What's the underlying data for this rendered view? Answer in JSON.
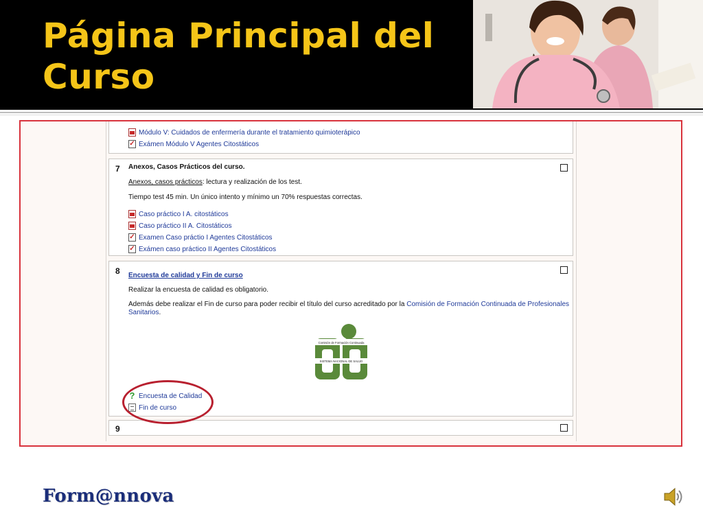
{
  "slide": {
    "title_line1": "Página Principal del",
    "title_line2": "Curso",
    "brand": "Form@nnova"
  },
  "colors": {
    "header_bg": "#000000",
    "title": "#f5c518",
    "frame_border": "#d8323c",
    "link": "#1f3a99",
    "logo_green": "#5a8a3a",
    "highlight_oval": "#b8202f"
  },
  "sections": {
    "prev": {
      "items": [
        {
          "icon": "pdf-icon",
          "label": "Módulo V: Cuidados de enfermería durante el tratamiento quimioterápico"
        },
        {
          "icon": "quiz-icon",
          "label": "Exámen Módulo V Agentes Citostáticos"
        }
      ]
    },
    "s7": {
      "number": "7",
      "title": "Anexos, Casos Prácticos del curso.",
      "summary_link": "Anexos, casos prácticos",
      "summary_rest": ": lectura y realización de los test.",
      "note": "Tiempo test 45 min. Un único intento y mínimo un 70% respuestas correctas.",
      "items": [
        {
          "icon": "pdf-icon",
          "label": "Caso práctico I A. citostáticos"
        },
        {
          "icon": "pdf-icon",
          "label": "Caso práctico II A. Citostáticos"
        },
        {
          "icon": "quiz-icon",
          "label": "Examen Caso práctio I Agentes Citostáticos"
        },
        {
          "icon": "quiz-icon",
          "label": "Exámen caso práctico II Agentes Citostáticos"
        }
      ]
    },
    "s8": {
      "number": "8",
      "title": "Encuesta de calidad y Fin de curso",
      "line1": "Realizar la encuesta de calidad es obligatorio.",
      "line2_start": "Además debe realizar el Fin de curso para poder recibir el título del curso acreditado por la",
      "line2_link_a": "Comisión de Formación Continuada de Profesionales",
      "line2_link_b": "Sanitarios",
      "line2_end": ".",
      "logo_top": "Comisión de Formación Continuada",
      "logo_bottom": "SISTEMA NACIONAL DE SALUD",
      "items": [
        {
          "icon": "help-icon",
          "label": "Encuesta de Calidad"
        },
        {
          "icon": "doc-icon",
          "label": "Fin de curso"
        }
      ]
    },
    "s9": {
      "number": "9"
    }
  }
}
